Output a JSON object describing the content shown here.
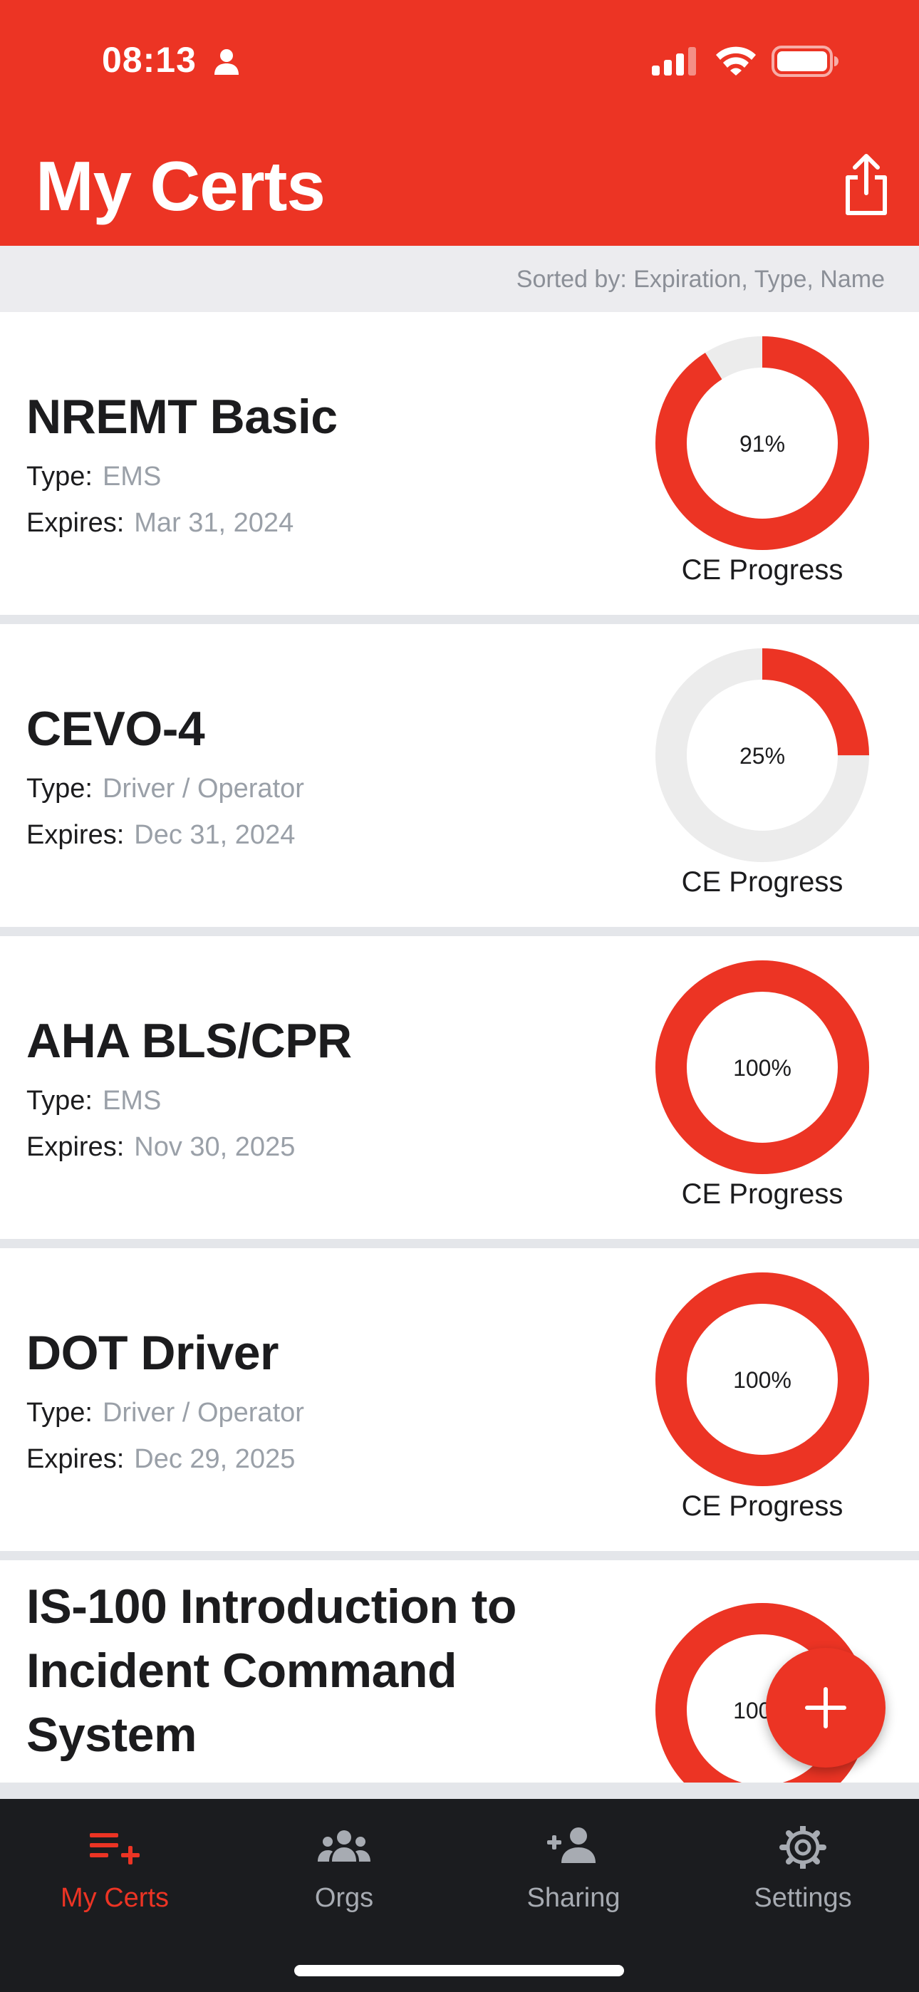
{
  "status_bar": {
    "time": "08:13"
  },
  "header": {
    "title": "My Certs"
  },
  "sort": {
    "text": "Sorted by: Expiration, Type, Name"
  },
  "labels": {
    "type": "Type:",
    "expires": "Expires:",
    "ce_progress": "CE Progress"
  },
  "certs": [
    {
      "name": "NREMT Basic",
      "type": "EMS",
      "expires": "Mar 31, 2024",
      "progress_pct": 91,
      "progress_label": "91%"
    },
    {
      "name": "CEVO-4",
      "type": "Driver / Operator",
      "expires": "Dec 31, 2024",
      "progress_pct": 25,
      "progress_label": "25%"
    },
    {
      "name": "AHA BLS/CPR",
      "type": "EMS",
      "expires": "Nov 30, 2025",
      "progress_pct": 100,
      "progress_label": "100%"
    },
    {
      "name": "DOT Driver",
      "type": "Driver / Operator",
      "expires": "Dec 29, 2025",
      "progress_pct": 100,
      "progress_label": "100%"
    },
    {
      "name_lines": [
        "IS-100 Introduction to",
        "Incident Command",
        "System"
      ],
      "progress_pct": 100,
      "progress_label": "100%"
    }
  ],
  "tabs": [
    {
      "label": "My Certs",
      "icon": "list-add-icon",
      "active": true
    },
    {
      "label": "Orgs",
      "icon": "group-icon",
      "active": false
    },
    {
      "label": "Sharing",
      "icon": "person-add-icon",
      "active": false
    },
    {
      "label": "Settings",
      "icon": "gear-icon",
      "active": false
    }
  ],
  "colors": {
    "accent": "#ec3424",
    "track": "#ececec",
    "tabbar": "#1b1c1f",
    "muted": "#9aa0a8"
  }
}
